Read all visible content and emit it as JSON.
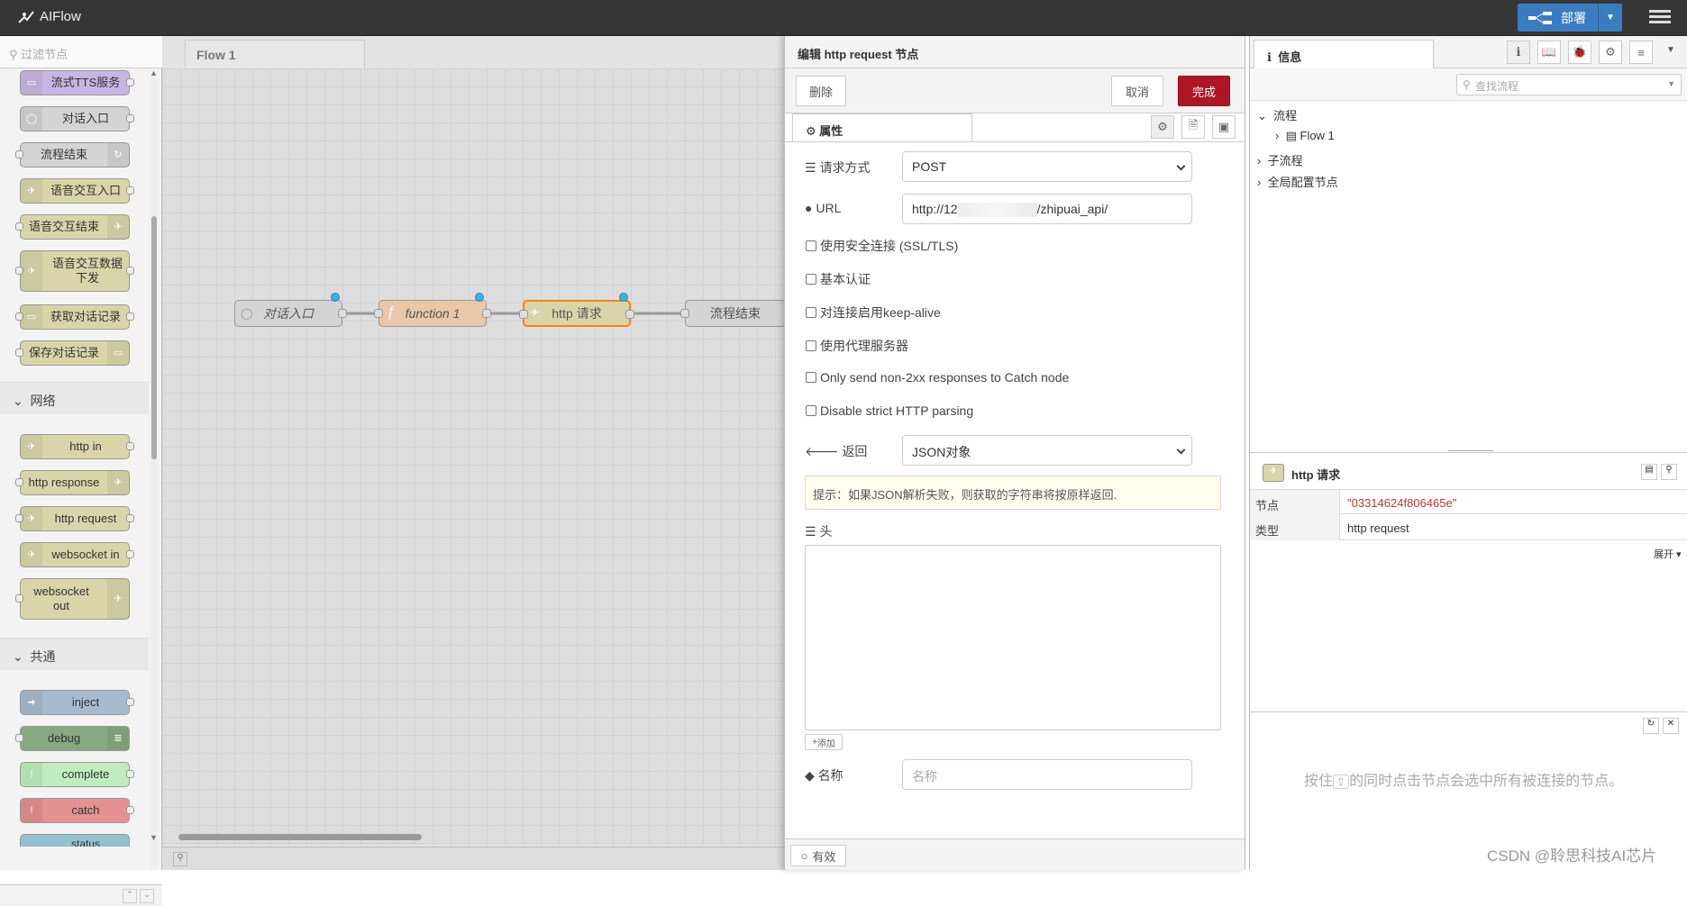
{
  "app": {
    "name": "AIFlow",
    "deploy_label": "部署"
  },
  "palette": {
    "filter_placeholder": "过滤节点",
    "nodes_top": [
      "流式TTS服务",
      "对话入口",
      "流程结束",
      "语音交互入口",
      "语音交互结束",
      "语音交互数据下发",
      "获取对话记录",
      "保存对话记录"
    ],
    "category_network": "网络",
    "nodes_network": [
      "http in",
      "http response",
      "http request",
      "websocket in",
      "websocket out"
    ],
    "category_common": "共通",
    "nodes_common": [
      "inject",
      "debug",
      "complete",
      "catch",
      "status"
    ]
  },
  "workspace": {
    "tab": "Flow 1",
    "flow_nodes": [
      "对话入口",
      "function 1",
      "http 请求",
      "流程结束"
    ]
  },
  "editor": {
    "title": "编辑 http request 节点",
    "delete_label": "删除",
    "cancel_label": "取消",
    "done_label": "完成",
    "properties_tab": "属性",
    "method_label": "请求方式",
    "method_value": "POST",
    "url_label": "URL",
    "url_value_prefix": "http://12",
    "url_value_suffix": "/zhipuai_api/",
    "checkboxes": [
      "使用安全连接 (SSL/TLS)",
      "基本认证",
      "对连接启用keep-alive",
      "使用代理服务器",
      "Only send non-2xx responses to Catch node",
      "Disable strict HTTP parsing"
    ],
    "return_label": "返回",
    "return_value": "JSON对象",
    "tip": "提示：如果JSON解析失败，则获取的字符串将按原样返回.",
    "headers_label": "头",
    "add_label": "添加",
    "name_label": "名称",
    "name_placeholder": "名称",
    "enabled_label": "有效"
  },
  "sidebar": {
    "info_tab": "信息",
    "search_placeholder": "查找流程",
    "tree": {
      "flows": "流程",
      "flow1": "Flow 1",
      "subflows": "子流程",
      "config_nodes": "全局配置节点"
    },
    "node_title": "http 请求",
    "node_key": "节点",
    "node_value": "\"03314624f806465e\"",
    "type_key": "类型",
    "type_value": "http request",
    "expand_label": "展开",
    "help_text_1": "按住",
    "help_key": "⇧",
    "help_text_2": "的同时点击节点会选中所有被连接的节点。"
  },
  "watermark": "CSDN @聆思科技AI芯片",
  "colors": {
    "header_bg": "#363636",
    "deploy": "#3a7cc2",
    "done_btn": "#ad1625",
    "node_value": "#c0392b"
  }
}
